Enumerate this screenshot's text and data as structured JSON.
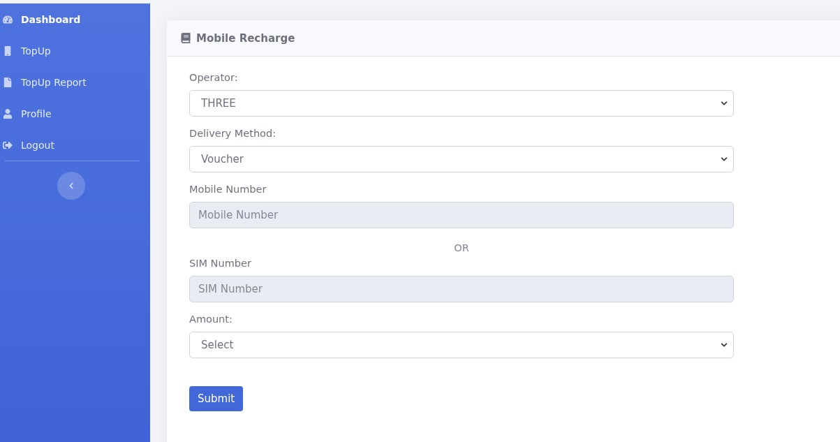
{
  "sidebar": {
    "items": [
      {
        "label": "Dashboard",
        "selected": true
      },
      {
        "label": "TopUp",
        "selected": false
      },
      {
        "label": "TopUp Report",
        "selected": false
      },
      {
        "label": "Profile",
        "selected": false
      },
      {
        "label": "Logout",
        "selected": false
      }
    ]
  },
  "card": {
    "title": "Mobile Recharge",
    "fields": [
      {
        "kind": "select",
        "label": "Operator:",
        "value": "THREE"
      },
      {
        "kind": "select",
        "label": "Delivery Method:",
        "value": "Voucher"
      },
      {
        "kind": "input",
        "label": "Mobile Number",
        "placeholder": "Mobile Number",
        "disabled": true
      },
      {
        "kind": "separator",
        "label": "OR"
      },
      {
        "kind": "input",
        "label": "SIM Number",
        "placeholder": "SIM Number",
        "disabled": true
      },
      {
        "kind": "select",
        "label": "Amount:",
        "value": "Select"
      }
    ],
    "submit": "Submit"
  }
}
